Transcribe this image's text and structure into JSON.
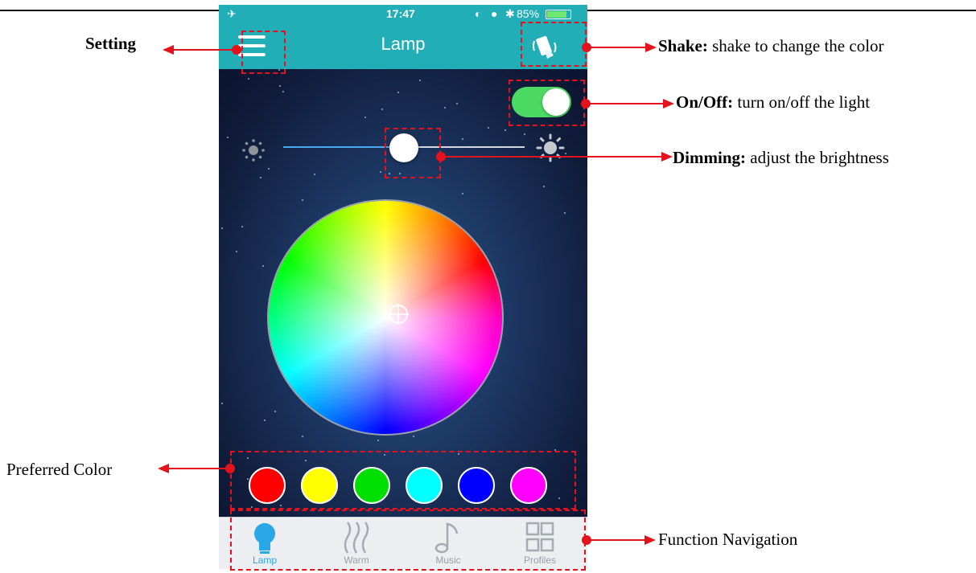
{
  "status_bar": {
    "airplane_icon": "airplane-icon",
    "time": "17:47",
    "battery_percent": "85%",
    "battery_level": 0.85
  },
  "nav": {
    "title": "Lamp"
  },
  "controls": {
    "power_on": true,
    "brightness_fraction": 0.5
  },
  "preferred_colors": [
    "#ff0000",
    "#ffff00",
    "#00e000",
    "#00ffff",
    "#0000ff",
    "#ff00ff"
  ],
  "tabs": [
    {
      "label": "Lamp",
      "icon": "bulb-icon",
      "active": true
    },
    {
      "label": "Warm",
      "icon": "warm-icon",
      "active": false
    },
    {
      "label": "Music",
      "icon": "music-note-icon",
      "active": false
    },
    {
      "label": "Profiles",
      "icon": "grid-icon",
      "active": false
    }
  ],
  "annotations": {
    "setting": "Setting",
    "shake_title": "Shake:",
    "shake_desc": " shake to change the color",
    "onoff_title": "On/Off:",
    "onoff_desc": " turn on/off the light",
    "dimming_title": "Dimming:",
    "dimming_desc": " adjust the brightness",
    "preferred": "Preferred Color",
    "function_nav": "Function Navigation"
  },
  "colors": {
    "accent_teal": "#21aeb6",
    "annotation_red": "#e4121c",
    "toggle_green": "#4cd964",
    "active_tab": "#2aa7e6"
  }
}
